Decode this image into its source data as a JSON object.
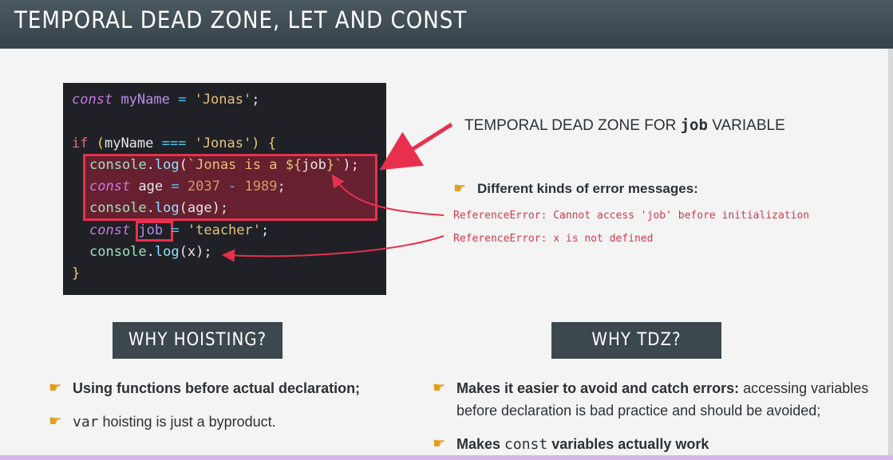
{
  "header": {
    "title": "TEMPORAL DEAD ZONE, LET AND CONST"
  },
  "code": {
    "line1": {
      "kw": "const",
      "name": "myName",
      "eq": " = ",
      "str": "'Jonas'",
      "end": ";"
    },
    "line3": {
      "kw": "if",
      "open": " (",
      "name": "myName",
      "op": " === ",
      "str": "'Jonas'",
      "close": ") {"
    },
    "line4": {
      "obj": "console",
      "dot": ".",
      "fn": "log",
      "p1": "(",
      "str1": "`Jonas is a ${",
      "var": "job",
      "str2": "}`",
      "p2": ");"
    },
    "line5": {
      "kw": "const",
      "name": " age",
      "eq": " = ",
      "n1": "2037",
      "op": " - ",
      "n2": "1989",
      "end": ";"
    },
    "line6": {
      "obj": "console",
      "dot": ".",
      "fn": "log",
      "p1": "(",
      "var": "age",
      "p2": ");"
    },
    "line7": {
      "kw": "const",
      "var": "job",
      "eq": " = ",
      "str": "'teacher'",
      "end": ";"
    },
    "line8": {
      "obj": "console",
      "dot": ".",
      "fn": "log",
      "p1": "(",
      "var": "x",
      "p2": ");"
    },
    "line9": {
      "close": "}"
    }
  },
  "tdz_label": {
    "prefix": "TEMPORAL DEAD ZONE FOR ",
    "var": "job",
    "suffix": " VARIABLE"
  },
  "errors": {
    "heading": "Different kinds of error messages:",
    "e1": "ReferenceError: Cannot access 'job' before initialization",
    "e2": "ReferenceError: x is not defined"
  },
  "why_hoisting": {
    "badge": "WHY HOISTING?",
    "b1": "Using functions before actual declaration;",
    "b2_mono": "var",
    "b2_text": " hoisting is just a byproduct."
  },
  "why_tdz": {
    "badge": "WHY TDZ?",
    "b1_bold": "Makes it easier to avoid and catch errors:",
    "b1_text": " accessing variables",
    "b1_line2": "before declaration is bad practice and should be avoided;",
    "b2_bold1": "Makes ",
    "b2_mono": "const",
    "b2_bold2": " variables actually work"
  },
  "colors": {
    "accent_red": "#e8304e",
    "header_bg": "#3c474e",
    "bullet_hand": "#e0a020"
  },
  "icons": {
    "bullet": "pointing-hand-icon"
  }
}
